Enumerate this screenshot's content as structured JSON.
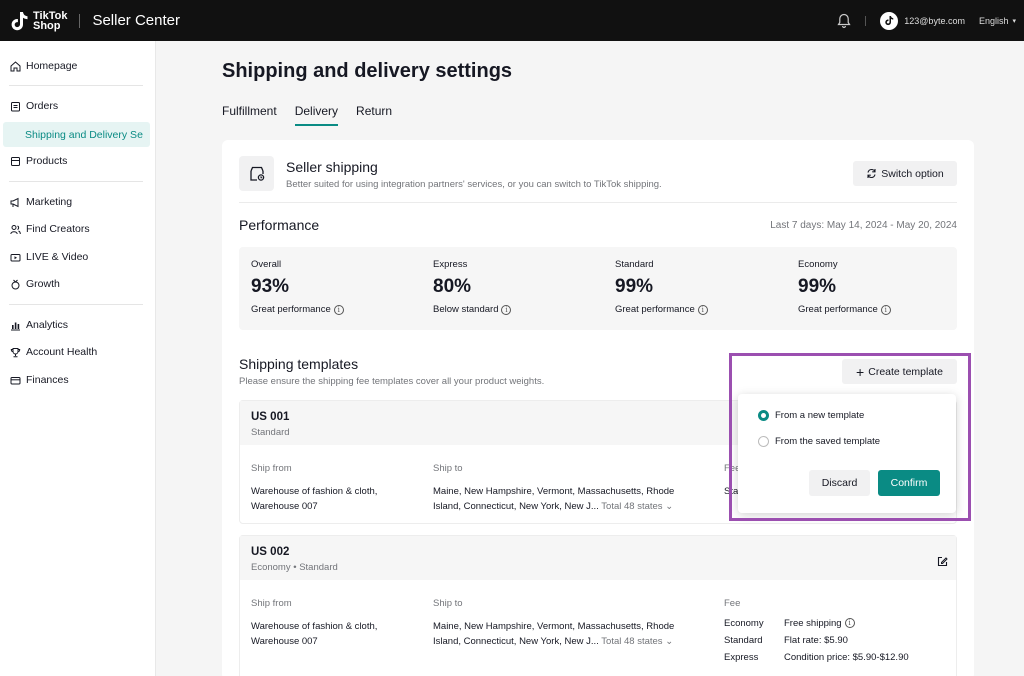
{
  "header": {
    "logo_line1": "TikTok",
    "logo_line2": "Shop",
    "app_title": "Seller Center",
    "email": "123@byte.com",
    "language": "English"
  },
  "sidebar": {
    "items": [
      {
        "label": "Homepage",
        "icon": "home-icon"
      },
      {
        "label": "Orders",
        "icon": "orders-icon"
      },
      {
        "label": "Shipping and Delivery Se",
        "icon": ""
      },
      {
        "label": "Products",
        "icon": "products-icon"
      },
      {
        "label": "Marketing",
        "icon": "megaphone-icon"
      },
      {
        "label": "Find Creators",
        "icon": "creators-icon"
      },
      {
        "label": "LIVE & Video",
        "icon": "video-icon"
      },
      {
        "label": "Growth",
        "icon": "growth-icon"
      },
      {
        "label": "Analytics",
        "icon": "analytics-icon"
      },
      {
        "label": "Account Health",
        "icon": "trophy-icon"
      },
      {
        "label": "Finances",
        "icon": "card-icon"
      }
    ]
  },
  "page": {
    "title": "Shipping and delivery settings",
    "tabs": [
      {
        "label": "Fulfillment",
        "active": false
      },
      {
        "label": "Delivery",
        "active": true
      },
      {
        "label": "Return",
        "active": false
      }
    ]
  },
  "seller_shipping": {
    "title": "Seller shipping",
    "description": "Better suited for using integration partners' services, or you can switch to TikTok shipping.",
    "switch_label": "Switch option"
  },
  "performance": {
    "title": "Performance",
    "range": "Last 7 days: May 14, 2024 - May 20, 2024",
    "metrics": [
      {
        "label": "Overall",
        "value": "93%",
        "note": "Great performance"
      },
      {
        "label": "Express",
        "value": "80%",
        "note": "Below standard"
      },
      {
        "label": "Standard",
        "value": "99%",
        "note": "Great performance"
      },
      {
        "label": "Economy",
        "value": "99%",
        "note": "Great performance"
      }
    ]
  },
  "templates": {
    "title": "Shipping templates",
    "description": "Please ensure the shipping fee templates cover all your product weights.",
    "create_label": "Create template",
    "items": [
      {
        "name": "US 001",
        "type": "Standard",
        "ship_from_label": "Ship from",
        "ship_from_line1": "Warehouse of fashion & cloth,",
        "ship_from_line2": "Warehouse 007",
        "ship_to_label": "Ship to",
        "ship_to_line1": "Maine, New Hampshire, Vermont, Massachusetts, Rhode",
        "ship_to_line2": "Island, Connecticut, New York, New J...",
        "ship_to_total": "Total 48 states",
        "fee_label": "Fee",
        "fee_partial": "Sta"
      },
      {
        "name": "US 002",
        "type": "Economy • Standard",
        "ship_from_label": "Ship from",
        "ship_from_line1": "Warehouse of fashion & cloth,",
        "ship_from_line2": "Warehouse 007",
        "ship_to_label": "Ship to",
        "ship_to_line1": "Maine, New Hampshire, Vermont, Massachusetts, Rhode",
        "ship_to_line2": "Island, Connecticut, New York, New J...",
        "ship_to_total": "Total 48 states",
        "fee_label": "Fee",
        "fees": [
          {
            "k": "Economy",
            "v": "Free shipping"
          },
          {
            "k": "Standard",
            "v": "Flat rate: $5.90"
          },
          {
            "k": "Express",
            "v": "Condition price: $5.90-$12.90"
          }
        ]
      }
    ]
  },
  "popover": {
    "option_new": "From a new template",
    "option_saved": "From the saved template",
    "selected": "new",
    "discard_label": "Discard",
    "confirm_label": "Confirm"
  },
  "colors": {
    "accent": "#0a8b84",
    "highlight": "#9b4fb0",
    "topbar": "#111111"
  }
}
